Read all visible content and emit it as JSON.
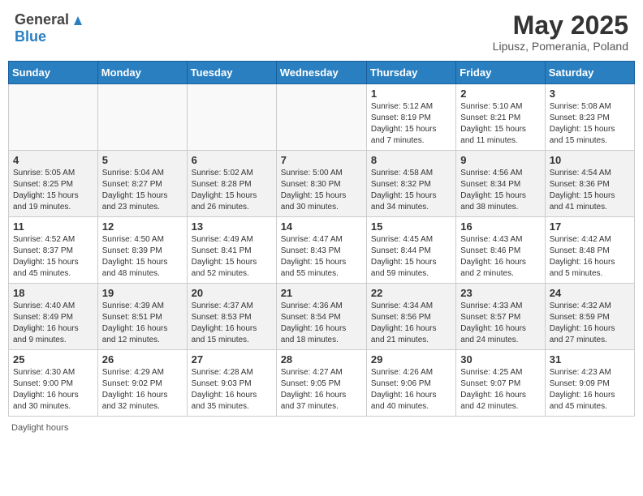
{
  "header": {
    "logo_line1": "General",
    "logo_line2": "Blue",
    "month": "May 2025",
    "location": "Lipusz, Pomerania, Poland"
  },
  "days_of_week": [
    "Sunday",
    "Monday",
    "Tuesday",
    "Wednesday",
    "Thursday",
    "Friday",
    "Saturday"
  ],
  "footer": {
    "daylight_label": "Daylight hours"
  },
  "weeks": [
    {
      "days": [
        {
          "num": "",
          "info": ""
        },
        {
          "num": "",
          "info": ""
        },
        {
          "num": "",
          "info": ""
        },
        {
          "num": "",
          "info": ""
        },
        {
          "num": "1",
          "info": "Sunrise: 5:12 AM\nSunset: 8:19 PM\nDaylight: 15 hours\nand 7 minutes."
        },
        {
          "num": "2",
          "info": "Sunrise: 5:10 AM\nSunset: 8:21 PM\nDaylight: 15 hours\nand 11 minutes."
        },
        {
          "num": "3",
          "info": "Sunrise: 5:08 AM\nSunset: 8:23 PM\nDaylight: 15 hours\nand 15 minutes."
        }
      ]
    },
    {
      "days": [
        {
          "num": "4",
          "info": "Sunrise: 5:05 AM\nSunset: 8:25 PM\nDaylight: 15 hours\nand 19 minutes."
        },
        {
          "num": "5",
          "info": "Sunrise: 5:04 AM\nSunset: 8:27 PM\nDaylight: 15 hours\nand 23 minutes."
        },
        {
          "num": "6",
          "info": "Sunrise: 5:02 AM\nSunset: 8:28 PM\nDaylight: 15 hours\nand 26 minutes."
        },
        {
          "num": "7",
          "info": "Sunrise: 5:00 AM\nSunset: 8:30 PM\nDaylight: 15 hours\nand 30 minutes."
        },
        {
          "num": "8",
          "info": "Sunrise: 4:58 AM\nSunset: 8:32 PM\nDaylight: 15 hours\nand 34 minutes."
        },
        {
          "num": "9",
          "info": "Sunrise: 4:56 AM\nSunset: 8:34 PM\nDaylight: 15 hours\nand 38 minutes."
        },
        {
          "num": "10",
          "info": "Sunrise: 4:54 AM\nSunset: 8:36 PM\nDaylight: 15 hours\nand 41 minutes."
        }
      ]
    },
    {
      "days": [
        {
          "num": "11",
          "info": "Sunrise: 4:52 AM\nSunset: 8:37 PM\nDaylight: 15 hours\nand 45 minutes."
        },
        {
          "num": "12",
          "info": "Sunrise: 4:50 AM\nSunset: 8:39 PM\nDaylight: 15 hours\nand 48 minutes."
        },
        {
          "num": "13",
          "info": "Sunrise: 4:49 AM\nSunset: 8:41 PM\nDaylight: 15 hours\nand 52 minutes."
        },
        {
          "num": "14",
          "info": "Sunrise: 4:47 AM\nSunset: 8:43 PM\nDaylight: 15 hours\nand 55 minutes."
        },
        {
          "num": "15",
          "info": "Sunrise: 4:45 AM\nSunset: 8:44 PM\nDaylight: 15 hours\nand 59 minutes."
        },
        {
          "num": "16",
          "info": "Sunrise: 4:43 AM\nSunset: 8:46 PM\nDaylight: 16 hours\nand 2 minutes."
        },
        {
          "num": "17",
          "info": "Sunrise: 4:42 AM\nSunset: 8:48 PM\nDaylight: 16 hours\nand 5 minutes."
        }
      ]
    },
    {
      "days": [
        {
          "num": "18",
          "info": "Sunrise: 4:40 AM\nSunset: 8:49 PM\nDaylight: 16 hours\nand 9 minutes."
        },
        {
          "num": "19",
          "info": "Sunrise: 4:39 AM\nSunset: 8:51 PM\nDaylight: 16 hours\nand 12 minutes."
        },
        {
          "num": "20",
          "info": "Sunrise: 4:37 AM\nSunset: 8:53 PM\nDaylight: 16 hours\nand 15 minutes."
        },
        {
          "num": "21",
          "info": "Sunrise: 4:36 AM\nSunset: 8:54 PM\nDaylight: 16 hours\nand 18 minutes."
        },
        {
          "num": "22",
          "info": "Sunrise: 4:34 AM\nSunset: 8:56 PM\nDaylight: 16 hours\nand 21 minutes."
        },
        {
          "num": "23",
          "info": "Sunrise: 4:33 AM\nSunset: 8:57 PM\nDaylight: 16 hours\nand 24 minutes."
        },
        {
          "num": "24",
          "info": "Sunrise: 4:32 AM\nSunset: 8:59 PM\nDaylight: 16 hours\nand 27 minutes."
        }
      ]
    },
    {
      "days": [
        {
          "num": "25",
          "info": "Sunrise: 4:30 AM\nSunset: 9:00 PM\nDaylight: 16 hours\nand 30 minutes."
        },
        {
          "num": "26",
          "info": "Sunrise: 4:29 AM\nSunset: 9:02 PM\nDaylight: 16 hours\nand 32 minutes."
        },
        {
          "num": "27",
          "info": "Sunrise: 4:28 AM\nSunset: 9:03 PM\nDaylight: 16 hours\nand 35 minutes."
        },
        {
          "num": "28",
          "info": "Sunrise: 4:27 AM\nSunset: 9:05 PM\nDaylight: 16 hours\nand 37 minutes."
        },
        {
          "num": "29",
          "info": "Sunrise: 4:26 AM\nSunset: 9:06 PM\nDaylight: 16 hours\nand 40 minutes."
        },
        {
          "num": "30",
          "info": "Sunrise: 4:25 AM\nSunset: 9:07 PM\nDaylight: 16 hours\nand 42 minutes."
        },
        {
          "num": "31",
          "info": "Sunrise: 4:23 AM\nSunset: 9:09 PM\nDaylight: 16 hours\nand 45 minutes."
        }
      ]
    }
  ]
}
